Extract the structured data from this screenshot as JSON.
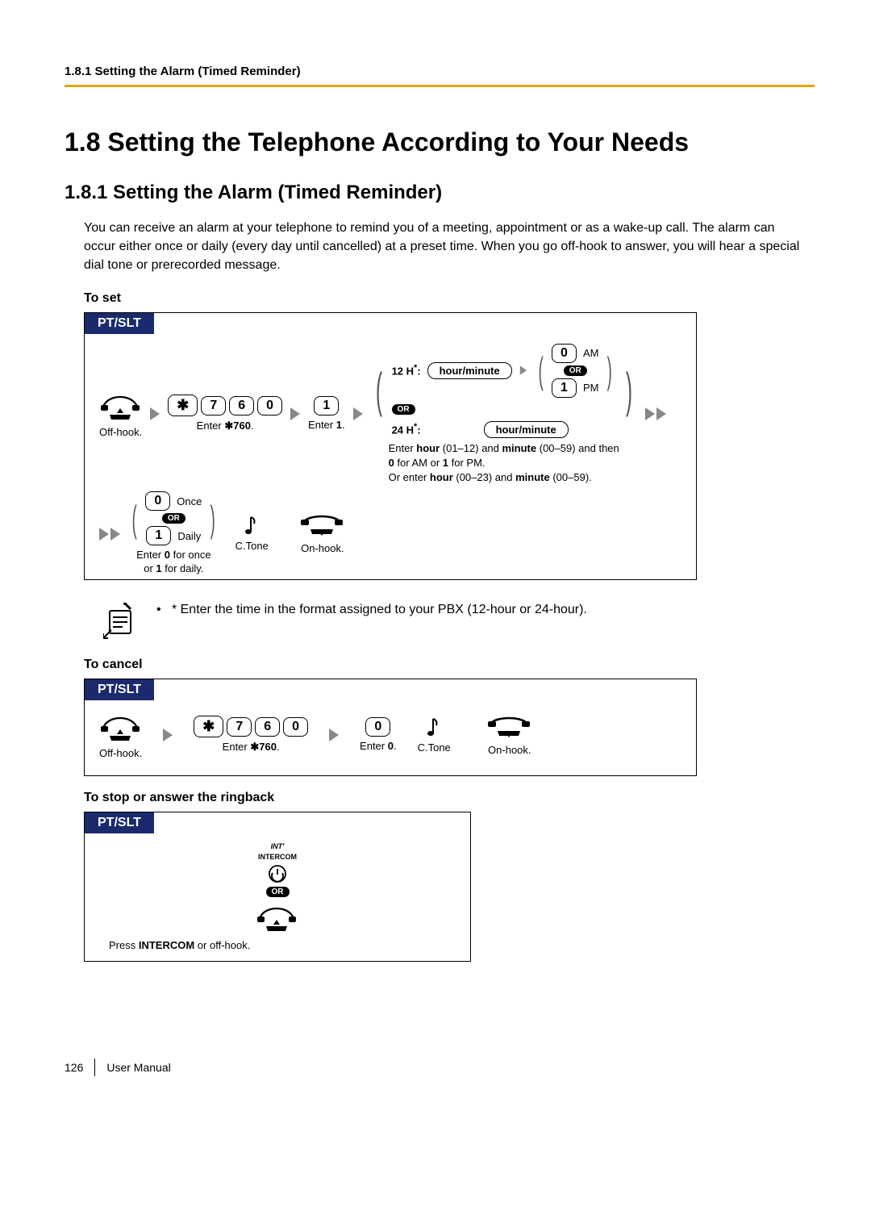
{
  "header": {
    "breadcrumb": "1.8.1 Setting the Alarm (Timed Reminder)"
  },
  "section": {
    "num_title": "1.8  Setting the Telephone According to Your Needs"
  },
  "subsection": {
    "num_title": "1.8.1  Setting the Alarm (Timed Reminder)"
  },
  "intro": "You can receive an alarm at your telephone to remind you of a meeting, appointment or as a wake-up call. The alarm can occur either once or daily (every day until cancelled) at a preset time. When you go off-hook to answer, you will hear a special dial tone or prerecorded message.",
  "proc_set": {
    "title": "To set",
    "tab": "PT/SLT",
    "offhook": "Off-hook.",
    "code_keys": [
      "✱",
      "7",
      "6",
      "0"
    ],
    "code_caption_a": "Enter ",
    "code_caption_b": "✱",
    "code_caption_c": "760",
    "code_caption_d": ".",
    "one_key": "1",
    "one_caption_a": "Enter ",
    "one_caption_b": "1",
    "one_caption_c": ".",
    "fmt12": "12 H",
    "fmt24": "24 H",
    "star_sup": "*",
    "colon": ":",
    "hm": "hour/minute",
    "am_key": "0",
    "am_label": "AM",
    "pm_key": "1",
    "pm_label": "PM",
    "or": "OR",
    "explain_l1a": "Enter ",
    "explain_l1b": "hour",
    "explain_l1c": " (01–12) and ",
    "explain_l1d": "minute",
    "explain_l1e": " (00–59) and then",
    "explain_l2a": "0",
    "explain_l2b": " for AM or ",
    "explain_l2c": "1",
    "explain_l2d": " for PM.",
    "explain_l3a": "Or enter ",
    "explain_l3b": "hour",
    "explain_l3c": " (00–23) and ",
    "explain_l3d": "minute",
    "explain_l3e": " (00–59).",
    "once_key": "0",
    "once_label": "Once",
    "daily_key": "1",
    "daily_label": "Daily",
    "once_daily_cap_a": "Enter ",
    "once_daily_cap_b": "0",
    "once_daily_cap_c": " for once",
    "once_daily_cap_d": "or ",
    "once_daily_cap_e": "1",
    "once_daily_cap_f": " for daily.",
    "ctone": "C.Tone",
    "onhook": "On-hook."
  },
  "note": {
    "bullet": "•",
    "text": "* Enter the time in the format assigned to your PBX (12-hour or 24-hour)."
  },
  "proc_cancel": {
    "title": "To cancel",
    "tab": "PT/SLT",
    "offhook": "Off-hook.",
    "code_keys": [
      "✱",
      "7",
      "6",
      "0"
    ],
    "code_caption_a": "Enter ",
    "code_caption_b": "✱",
    "code_caption_c": "760",
    "code_caption_d": ".",
    "zero_key": "0",
    "zero_caption_a": "Enter ",
    "zero_caption_b": "0",
    "zero_caption_c": ".",
    "ctone": "C.Tone",
    "onhook": "On-hook."
  },
  "proc_stop": {
    "title": "To stop or answer the ringback",
    "tab": "PT/SLT",
    "intx": "INT'",
    "intercom": "INTERCOM",
    "or": "OR",
    "caption_a": "Press ",
    "caption_b": "INTERCOM",
    "caption_c": " or off-hook."
  },
  "footer": {
    "page": "126",
    "manual": "User Manual"
  }
}
